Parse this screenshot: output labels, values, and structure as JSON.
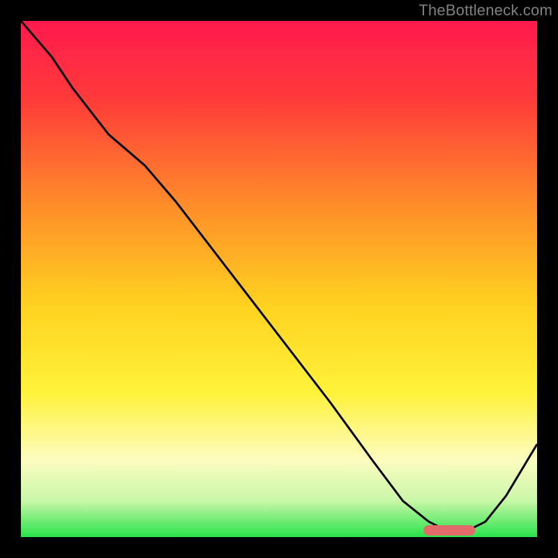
{
  "watermark": "TheBottleneck.com",
  "chart_data": {
    "type": "line",
    "title": "",
    "xlabel": "",
    "ylabel": "",
    "xlim": [
      0,
      100
    ],
    "ylim": [
      0,
      100
    ],
    "legend_position": "none",
    "grid": false,
    "background_gradient": {
      "stops": [
        {
          "offset": 0.0,
          "color": "#ff1a4d"
        },
        {
          "offset": 0.15,
          "color": "#ff3a3a"
        },
        {
          "offset": 0.35,
          "color": "#ff8a2a"
        },
        {
          "offset": 0.55,
          "color": "#ffd21f"
        },
        {
          "offset": 0.72,
          "color": "#fff23a"
        },
        {
          "offset": 0.85,
          "color": "#fdfcc0"
        },
        {
          "offset": 0.93,
          "color": "#c9f7a8"
        },
        {
          "offset": 1.0,
          "color": "#27e34a"
        }
      ]
    },
    "series": [
      {
        "name": "bottleneck-curve",
        "color": "#000000",
        "x": [
          0,
          6,
          10,
          17,
          24,
          30,
          40,
          50,
          60,
          68,
          74,
          79,
          83,
          86,
          90,
          94,
          100
        ],
        "values": [
          100,
          93,
          87,
          78,
          72,
          65,
          52,
          39,
          26,
          15,
          7,
          3,
          1,
          1,
          3,
          8,
          18
        ]
      }
    ],
    "markers": [
      {
        "name": "optimal-range",
        "shape": "rounded-bar",
        "color": "#e36a6a",
        "x_start": 78,
        "x_end": 88,
        "y": 1.3,
        "thickness": 2.0
      }
    ]
  }
}
